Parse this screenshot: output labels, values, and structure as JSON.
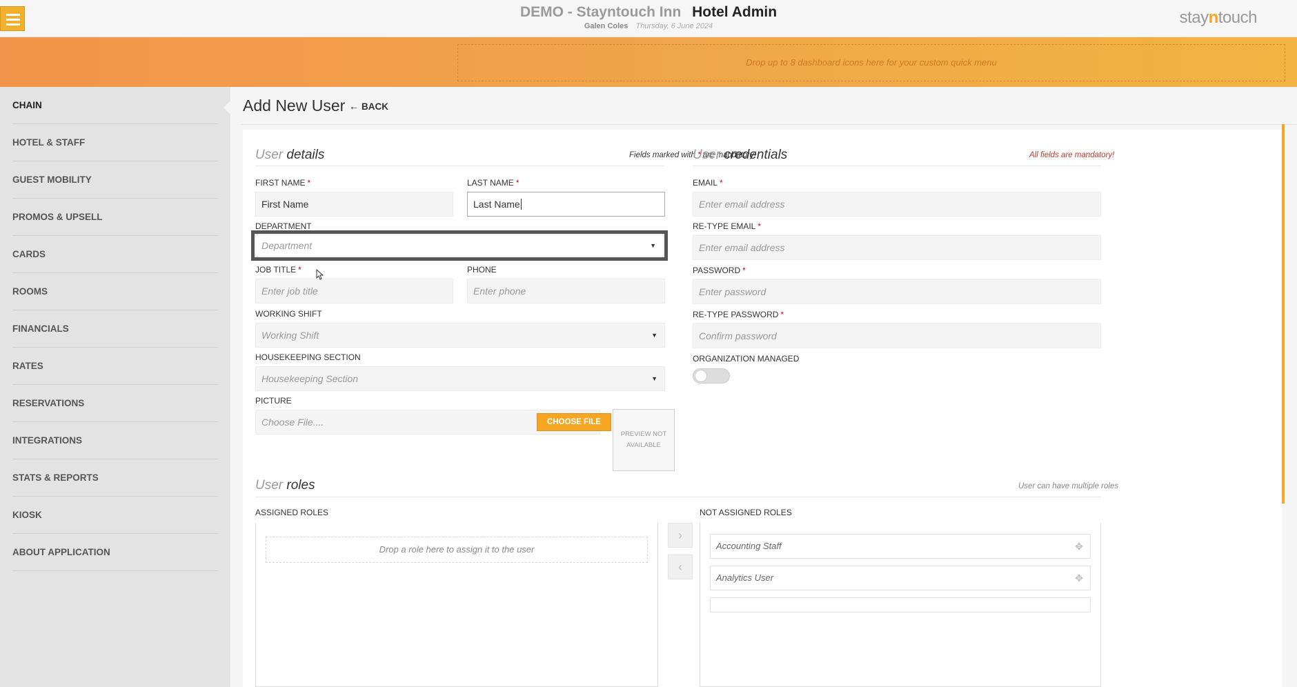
{
  "header": {
    "hotel": "DEMO - Stayntouch Inn",
    "app": "Hotel Admin",
    "user": "Galen Coles",
    "date": "Thursday, 6 June 2024",
    "logo_prefix": "stay",
    "logo_accent": "n",
    "logo_suffix": "touch"
  },
  "dashboard": {
    "drop_text": "Drop up to 8 dashboard icons here for your custom quick menu"
  },
  "sidebar": {
    "items": [
      {
        "label": "CHAIN"
      },
      {
        "label": "HOTEL & STAFF"
      },
      {
        "label": "GUEST MOBILITY"
      },
      {
        "label": "PROMOS & UPSELL"
      },
      {
        "label": "CARDS"
      },
      {
        "label": "ROOMS"
      },
      {
        "label": "FINANCIALS"
      },
      {
        "label": "RATES"
      },
      {
        "label": "RESERVATIONS"
      },
      {
        "label": "INTEGRATIONS"
      },
      {
        "label": "STATS & REPORTS"
      },
      {
        "label": "KIOSK"
      },
      {
        "label": "ABOUT APPLICATION"
      }
    ]
  },
  "page": {
    "title": "Add New User",
    "back_label": "BACK"
  },
  "details": {
    "title_prefix": "User",
    "title_main": "details",
    "note_before": "Fields marked with ",
    "note_star": "*",
    "note_after": " are mandatory!",
    "first_name_label": "FIRST NAME",
    "first_name_value": "First Name",
    "last_name_label": "LAST NAME",
    "last_name_value": "Last Name",
    "department_label": "DEPARTMENT",
    "department_placeholder": "Department",
    "job_title_label": "JOB TITLE",
    "job_title_placeholder": "Enter job title",
    "phone_label": "PHONE",
    "phone_placeholder": "Enter phone",
    "shift_label": "WORKING SHIFT",
    "shift_placeholder": "Working Shift",
    "hk_label": "HOUSEKEEPING SECTION",
    "hk_placeholder": "Housekeeping Section",
    "picture_label": "PICTURE",
    "picture_placeholder": "Choose File....",
    "choose_file_button": "CHOOSE FILE",
    "preview_line1": "PREVIEW NOT",
    "preview_line2": "AVAILABLE",
    "required_mark": "*"
  },
  "credentials": {
    "title_prefix": "User",
    "title_main": "credentials",
    "note": "All fields are mandatory!",
    "email_label": "EMAIL",
    "email_placeholder": "Enter email address",
    "retype_email_label": "RE-TYPE EMAIL",
    "retype_email_placeholder": "Enter email address",
    "password_label": "PASSWORD",
    "password_placeholder": "Enter password",
    "retype_password_label": "RE-TYPE PASSWORD",
    "retype_password_placeholder": "Confirm password",
    "org_managed_label": "ORGANIZATION MANAGED",
    "org_managed_on": false
  },
  "roles": {
    "title_prefix": "User",
    "title_main": "roles",
    "note": "User can have multiple roles",
    "assigned_label": "ASSIGNED ROLES",
    "assigned_drop_text": "Drop a role here to assign it to the user",
    "not_assigned_label": "NOT ASSIGNED ROLES",
    "not_assigned": [
      {
        "label": "Accounting Staff"
      },
      {
        "label": "Analytics User"
      }
    ]
  }
}
